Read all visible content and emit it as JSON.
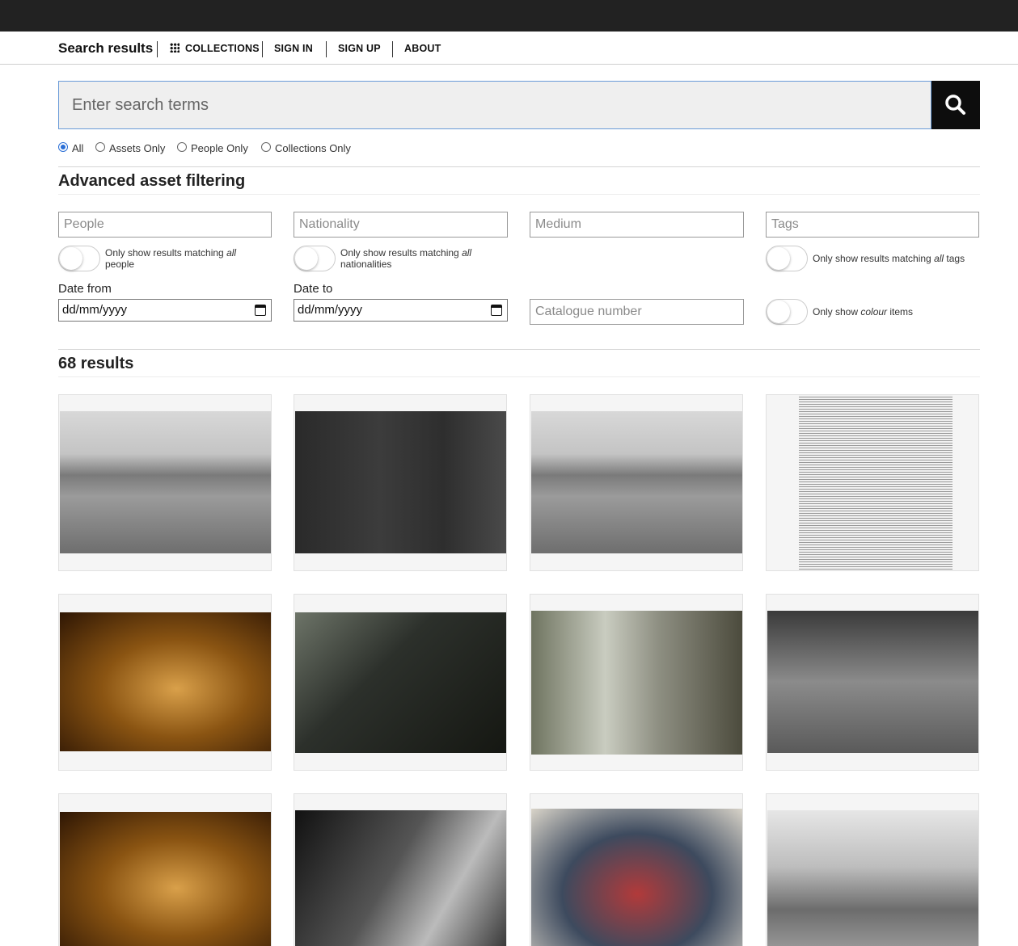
{
  "nav": {
    "title": "Search results",
    "links": [
      "COLLECTIONS",
      "SIGN IN",
      "SIGN UP",
      "ABOUT"
    ]
  },
  "search": {
    "placeholder": "Enter search terms",
    "button_icon": "search-icon"
  },
  "scope": {
    "options": [
      "All",
      "Assets Only",
      "People Only",
      "Collections Only"
    ],
    "selected": "All"
  },
  "filters": {
    "heading": "Advanced asset filtering",
    "people_placeholder": "People",
    "nationality_placeholder": "Nationality",
    "medium_placeholder": "Medium",
    "tags_placeholder": "Tags",
    "people_toggle": {
      "prefix": "Only show results matching ",
      "emph": "all",
      "suffix": " people"
    },
    "nationality_toggle": {
      "prefix": "Only show results matching ",
      "emph": "all",
      "suffix": " nationalities"
    },
    "tags_toggle": {
      "prefix": "Only show results matching ",
      "emph": "all",
      "suffix": " tags"
    },
    "colour_toggle": {
      "prefix": "Only show ",
      "emph": "colour",
      "suffix": " items"
    },
    "date_from_label": "Date from",
    "date_to_label": "Date to",
    "date_from_value": "dd/mm/yyyy",
    "date_to_value": "dd/mm/yyyy",
    "catalogue_placeholder": "Catalogue number"
  },
  "results": {
    "count_label": "68 results",
    "items": [
      {
        "kind": "bw-field"
      },
      {
        "kind": "bw-blackboard"
      },
      {
        "kind": "bw-field"
      },
      {
        "kind": "newsprint"
      },
      {
        "kind": "colour-warm"
      },
      {
        "kind": "dark-office"
      },
      {
        "kind": "colour-window"
      },
      {
        "kind": "bw-street"
      },
      {
        "kind": "colour-warm"
      },
      {
        "kind": "bw-portrait"
      },
      {
        "kind": "colour-flowers"
      },
      {
        "kind": "bw-harbour"
      }
    ]
  },
  "colors": {
    "topbar": "#222222",
    "search_button": "#0d0d0d",
    "radio_accent": "#2b6fd6",
    "search_border": "#6a9bd8"
  }
}
